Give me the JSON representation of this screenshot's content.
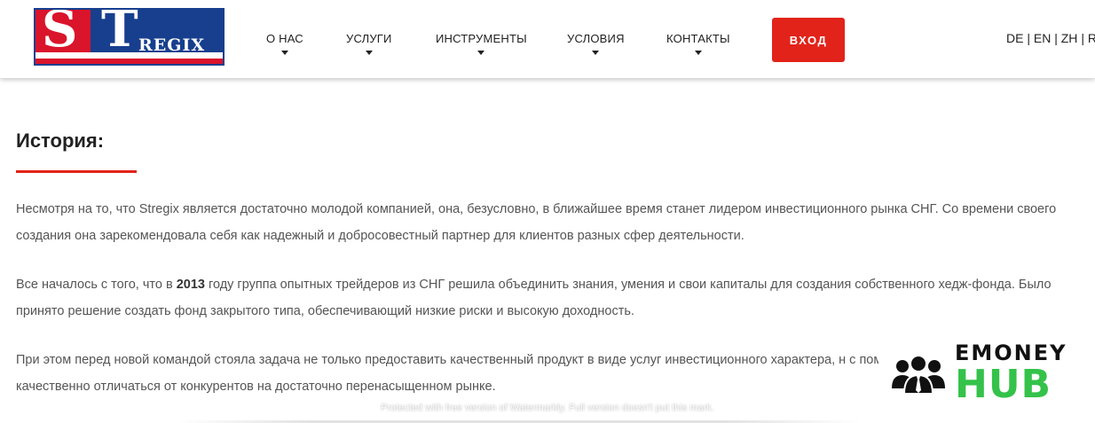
{
  "logo": {
    "letter_s": "S",
    "letter_t": "T",
    "text": "REGIX",
    "colors": {
      "red": "#d9142b",
      "blue": "#173f8e"
    }
  },
  "nav": {
    "items": [
      {
        "label": "О НАС"
      },
      {
        "label": "УСЛУГИ"
      },
      {
        "label": "ИНСТРУМЕНТЫ"
      },
      {
        "label": "УСЛОВИЯ"
      },
      {
        "label": "КОНТАКТЫ"
      }
    ],
    "login_label": "ВХОД",
    "login_color": "#e2231a",
    "languages": [
      "DE",
      "EN",
      "ZH",
      "R"
    ]
  },
  "content": {
    "title": "История:",
    "accent_color": "#e2231a",
    "paragraph1": "Несмотря на то, что Stregix является достаточно молодой компанией, она, безусловно, в ближайшее время станет лидером инвестиционного рынка СНГ. Со времени своего создания она зарекомендовала себя как надежный и добросовестный партнер для клиентов разных сфер деятельности.",
    "paragraph2_before": "Все началось с того, что в ",
    "paragraph2_year": "2013",
    "paragraph2_after": " году группа опытных трейдеров из СНГ решила объединить знания, умения и свои капиталы для создания собственного хедж-фонда. Было принято решение создать фонд закрытого типа, обеспечивающий низкие риски и высокую доходность.",
    "paragraph3": "При этом перед новой командой стояла задача не только предоставить качественный продукт в виде услуг инвестиционного характера, н с помощью которой компания будет качественно отличаться от конкурентов на достаточно перенасыщенном рынке."
  },
  "overlay": {
    "watermark_text": "Protected with free version of Watermarkly. Full version doesn't put this mark.",
    "badge_top": "EMONEY",
    "badge_bottom": "HUB",
    "badge_icon": "users-group-icon",
    "badge_color": "#34c24a"
  }
}
